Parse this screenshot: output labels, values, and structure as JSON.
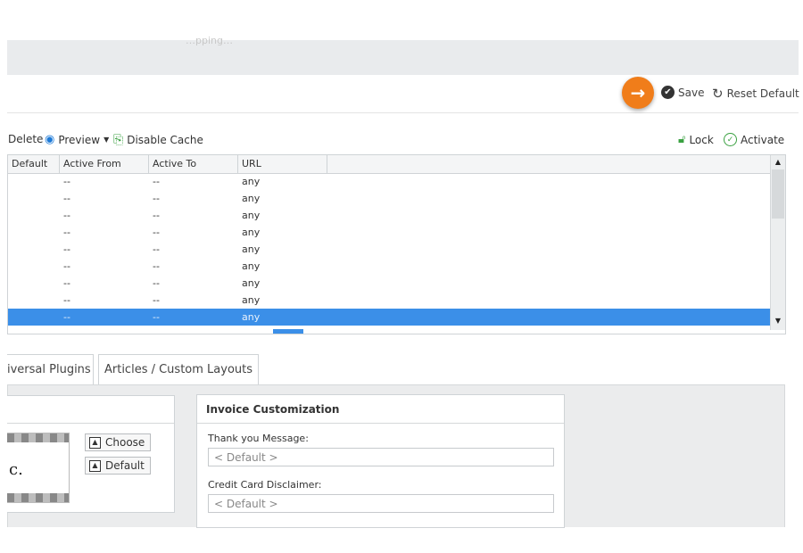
{
  "top_band": {
    "faint_text": "…pping…"
  },
  "header": {
    "go_icon": "arrow-right-icon",
    "save_label": "Save",
    "reset_label": "Reset Default"
  },
  "toolbar": {
    "delete_label": "Delete",
    "preview_label": "Preview",
    "disable_cache_label": "Disable Cache",
    "lock_label": "Lock",
    "activate_label": "Activate"
  },
  "grid": {
    "columns": [
      "Default",
      "Active From",
      "Active To",
      "URL"
    ],
    "rows": [
      [
        "",
        "--",
        "--",
        "any"
      ],
      [
        "",
        "--",
        "--",
        "any"
      ],
      [
        "",
        "--",
        "--",
        "any"
      ],
      [
        "",
        "--",
        "--",
        "any"
      ],
      [
        "",
        "--",
        "--",
        "any"
      ],
      [
        "",
        "--",
        "--",
        "any"
      ],
      [
        "",
        "--",
        "--",
        "any"
      ],
      [
        "",
        "--",
        "--",
        "any"
      ],
      [
        "",
        "--",
        "--",
        "any"
      ]
    ],
    "selected_row_index": 8,
    "selected_color": "#3b8fe8"
  },
  "tabs": [
    {
      "label": "iversal Plugins"
    },
    {
      "label": "Articles / Custom Layouts"
    }
  ],
  "logo_panel": {
    "logo_text": "c.",
    "choose_label": "Choose",
    "default_label": "Default"
  },
  "invoice": {
    "title": "Invoice Customization",
    "thank_you_label": "Thank you Message:",
    "thank_you_placeholder": "< Default >",
    "disclaimer_label": "Credit Card Disclaimer:",
    "disclaimer_placeholder": "< Default >"
  },
  "colors": {
    "accent": "#f07d1a",
    "link": "#1e7ad7",
    "success": "#3aa141"
  }
}
